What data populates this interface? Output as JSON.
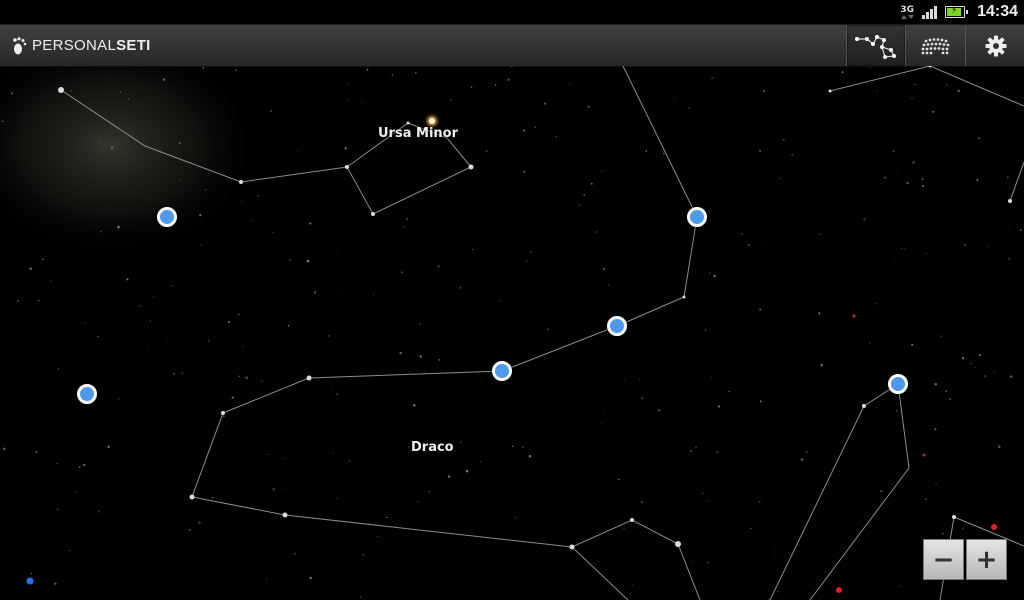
{
  "status_bar": {
    "network_type": "3G",
    "time": "14:34",
    "battery_level": 0.85,
    "battery_color": "#7ed321"
  },
  "app": {
    "logo_icon": "footprint-icon",
    "title_part1": "PERSONAL",
    "title_part2": "SETI"
  },
  "toolbar": {
    "buttons": [
      {
        "name": "constellation-lines-toggle",
        "icon": "constellation-icon",
        "active": true
      },
      {
        "name": "star-grid-toggle",
        "icon": "star-grid-icon",
        "active": false
      },
      {
        "name": "settings",
        "icon": "gear-icon",
        "active": false
      }
    ]
  },
  "sky": {
    "constellation_labels": [
      "Ursa Minor",
      "Draco"
    ],
    "marker_color": "#4f9ae8"
  },
  "zoom": {
    "out_label": "−",
    "in_label": "+"
  }
}
